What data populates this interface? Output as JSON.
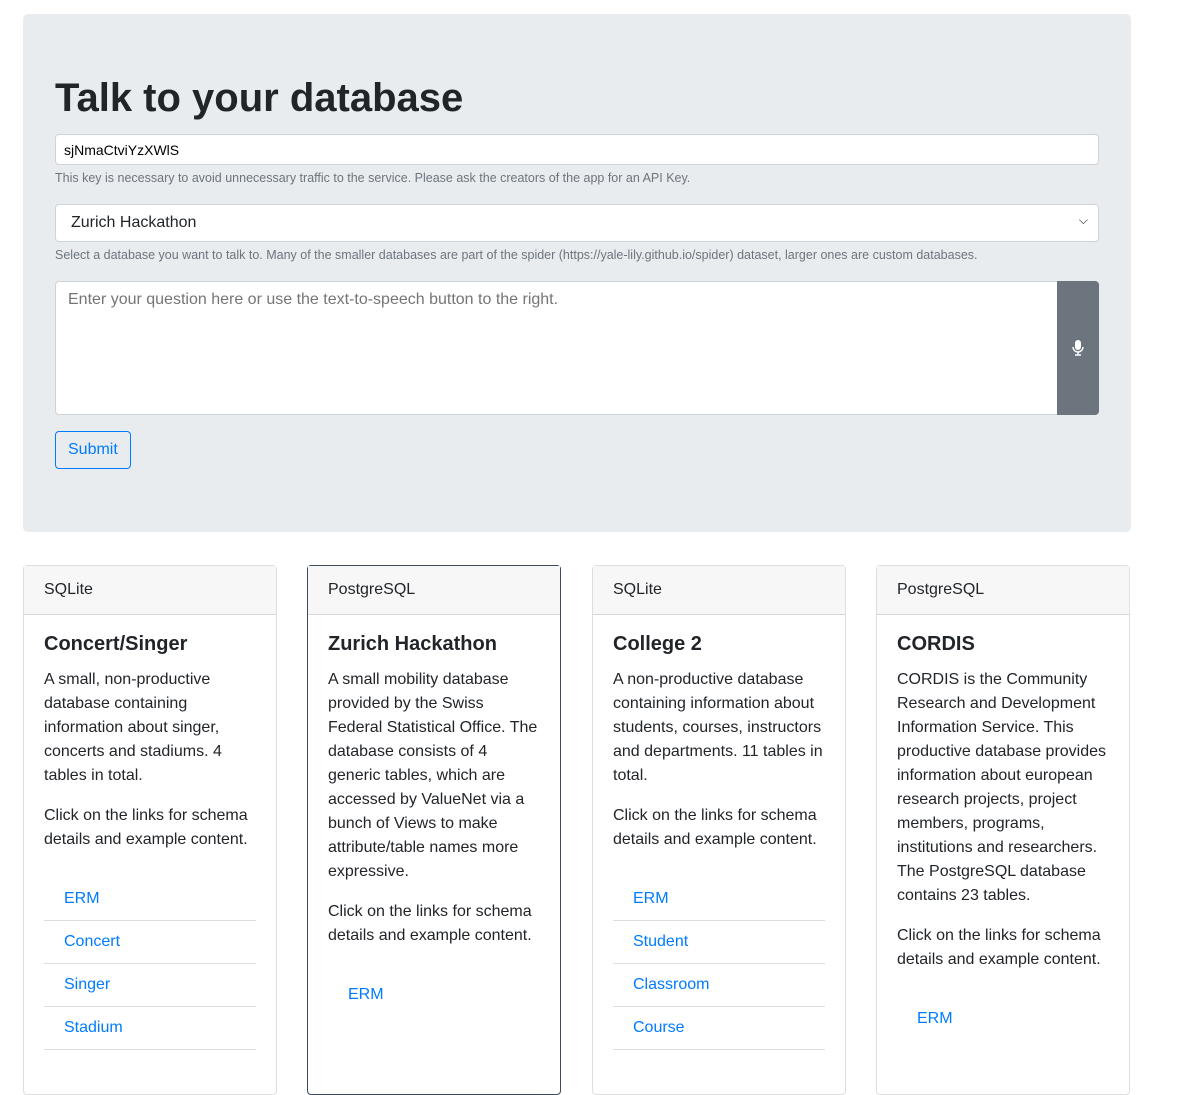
{
  "header": {
    "title": "Talk to your database"
  },
  "api_key": {
    "value": "sjNmaCtviYzXWlS",
    "help": "This key is necessary to avoid unnecessary traffic to the service. Please ask the creators of the app for an API Key."
  },
  "database_select": {
    "value": "Zurich Hackathon",
    "help": "Select a database you want to talk to. Many of the smaller databases are part of the spider (https://yale-lily.github.io/spider) dataset, larger ones are custom databases."
  },
  "question": {
    "placeholder": "Enter your question here or use the text-to-speech button to the right.",
    "mic_icon": "microphone-icon"
  },
  "submit_label": "Submit",
  "cards": [
    {
      "engine": "SQLite",
      "title": "Concert/Singer",
      "description": "A small, non-productive database containing information about singer, concerts and stadiums. 4 tables in total.",
      "hint": "Click on the links for schema details and example content.",
      "links": [
        "ERM",
        "Concert",
        "Singer",
        "Stadium"
      ]
    },
    {
      "engine": "PostgreSQL",
      "title": "Zurich Hackathon",
      "description": "A small mobility database provided by the Swiss Federal Statistical Office. The database consists of 4 generic tables, which are accessed by ValueNet via a bunch of Views to make attribute/table names more expressive.",
      "hint": "Click on the links for schema details and example content.",
      "links": [
        "ERM"
      ]
    },
    {
      "engine": "SQLite",
      "title": "College 2",
      "description": "A non-productive database containing information about students, courses, instructors and departments. 11 tables in total.",
      "hint": "Click on the links for schema details and example content.",
      "links": [
        "ERM",
        "Student",
        "Classroom",
        "Course"
      ]
    },
    {
      "engine": "PostgreSQL",
      "title": "CORDIS",
      "description": "CORDIS is the Community Research and Development Information Service. This productive database provides information about european research projects, project members, programs, institutions and researchers. The PostgreSQL database contains 23 tables.",
      "hint": "Click on the links for schema details and example content.",
      "links": [
        "ERM"
      ]
    }
  ]
}
